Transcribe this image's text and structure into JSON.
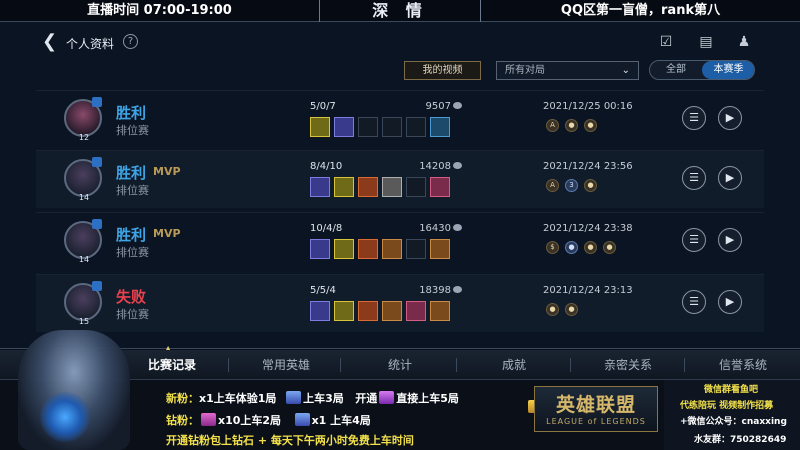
{
  "banner": {
    "left": "直播时间 07:00-19:00",
    "center": "深 情",
    "right": "QQ区第一盲僧，rank第八"
  },
  "header": {
    "title": "个人资料",
    "help": "?",
    "icons": [
      "task-icon",
      "chat-icon",
      "friends-icon"
    ]
  },
  "filters": {
    "my_videos": "我的视频",
    "match_select": "所有对局",
    "toggle_all": "全部",
    "toggle_season": "本赛季"
  },
  "matches": [
    {
      "result": "胜利",
      "mvp": "",
      "mode": "排位赛",
      "level": "12",
      "kda": "5/0/7",
      "gold": "9507",
      "date": "2021/12/25 00:16",
      "medals": [
        "A",
        "●",
        "●"
      ]
    },
    {
      "result": "胜利",
      "mvp": "MVP",
      "mode": "排位赛",
      "level": "14",
      "kda": "8/4/10",
      "gold": "14208",
      "date": "2021/12/24 23:56",
      "medals": [
        "A",
        "3",
        "●"
      ]
    },
    {
      "result": "胜利",
      "mvp": "MVP",
      "mode": "排位赛",
      "level": "14",
      "kda": "10/4/8",
      "gold": "16430",
      "date": "2021/12/24 23:38",
      "medals": [
        "$",
        "●",
        "●",
        "●"
      ]
    },
    {
      "result": "失败",
      "mvp": "",
      "mode": "排位赛",
      "level": "15",
      "kda": "5/5/4",
      "gold": "18398",
      "date": "2021/12/24 23:13",
      "medals": [
        "●",
        "●"
      ]
    }
  ],
  "tabs": [
    "比赛记录",
    "常用英雄",
    "统计",
    "成就",
    "亲密关系",
    "信誉系统"
  ],
  "overlay": {
    "line1_a": "新粉：",
    "line1_b": "x1上车体验1局",
    "line1_c": "上车3局",
    "line1_d": "开通",
    "line1_e": "直接上车5局",
    "line2_a": "钻粉：",
    "line2_b": "x10上车2局",
    "line2_c": "x1 上车4局",
    "line3": "开通钻粉包上钻石 + 每天下午两小时免费上车时间"
  },
  "logo": {
    "cn": "英雄联盟",
    "en": "LEAGUE of LEGENDS"
  },
  "side": {
    "l1": "微信群看鱼吧",
    "l2": "代练陪玩  视频制作招募",
    "l3": "+微信公众号：cnaxxing",
    "l4": "水友群：750282649"
  },
  "colors": {
    "win": "#3da5e6",
    "loss": "#e8424e",
    "mvp": "#b99a56",
    "accent": "#1d5ea6"
  }
}
